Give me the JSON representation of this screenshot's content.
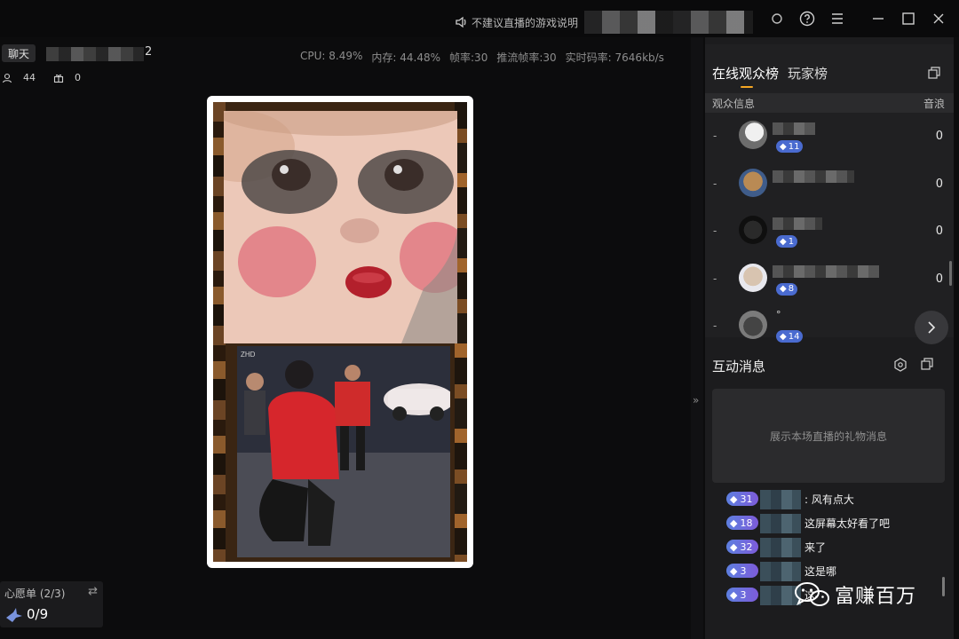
{
  "titlebar": {
    "notice": "不建议直播的游戏说明"
  },
  "stream": {
    "chat_tab": "聊天",
    "name_suffix": "2",
    "stats": {
      "cpu": "CPU: 8.49%",
      "memory": "内存: 44.48%",
      "fps": "帧率:30",
      "push_fps": "推流帧率:30",
      "bitrate": "实时码率: 7646kb/s"
    },
    "viewers": "44",
    "gifts": "0",
    "video_watermark": "ZHD"
  },
  "wishlist": {
    "title": "心愿单 (2/3)",
    "count": "0/9"
  },
  "audience": {
    "tabs": [
      "在线观众榜",
      "玩家榜"
    ],
    "header_left": "观众信息",
    "header_right": "音浪",
    "rows": [
      {
        "rank": "-",
        "level": "11",
        "value": "0",
        "name": ""
      },
      {
        "rank": "-",
        "level": "",
        "value": "0",
        "name": ""
      },
      {
        "rank": "-",
        "level": "1",
        "value": "0",
        "name": ""
      },
      {
        "rank": "-",
        "level": "8",
        "value": "0",
        "name": ""
      },
      {
        "rank": "-",
        "level": "14",
        "value": "",
        "name": "°"
      }
    ]
  },
  "interaction": {
    "title": "互动消息",
    "gift_placeholder": "展示本场直播的礼物消息",
    "messages": [
      {
        "level": "31",
        "text": ": 风有点大"
      },
      {
        "level": "18",
        "text": "这屏幕太好看了吧"
      },
      {
        "level": "32",
        "text": "来了"
      },
      {
        "level": "3",
        "text": "这是哪"
      },
      {
        "level": "3",
        "text": "这"
      }
    ]
  },
  "watermark": {
    "text": "富赚百万"
  },
  "colors": {
    "accent": "#f5a623",
    "level_badge": "#4a6bd0",
    "background": "#0c0c0d",
    "panel": "#1c1c1e"
  }
}
